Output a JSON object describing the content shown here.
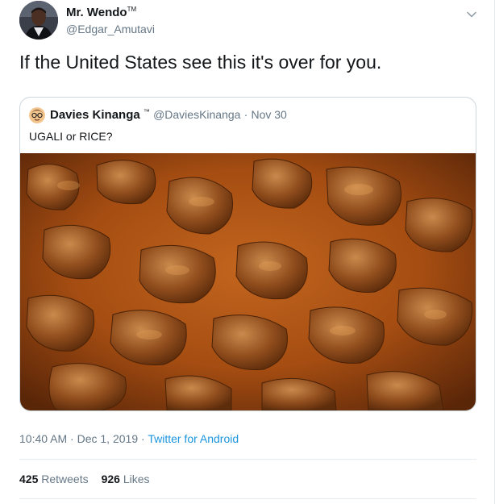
{
  "author": {
    "display_name": "Mr. Wendo",
    "tm": "TM",
    "handle": "@Edgar_Amutavi",
    "avatar_icon": "user-avatar"
  },
  "tweet": {
    "text": "If the United States see this it's over for you."
  },
  "quoted_tweet": {
    "display_name": "Davies Kinanga",
    "tm": "™",
    "handle": "@DaviesKinanga",
    "separator": "·",
    "date": "Nov 30",
    "text": "UGALI or RICE?",
    "image_icon": "food-photo"
  },
  "meta": {
    "time": "10:40 AM",
    "separator": "·",
    "date": "Dec 1, 2019",
    "source": "Twitter for Android"
  },
  "stats": {
    "retweets_count": "425",
    "retweets_label": "Retweets",
    "likes_count": "926",
    "likes_label": "Likes"
  },
  "colors": {
    "accent": "#1b95e0",
    "secondary_text": "#657786",
    "border": "#ccd6dd"
  }
}
